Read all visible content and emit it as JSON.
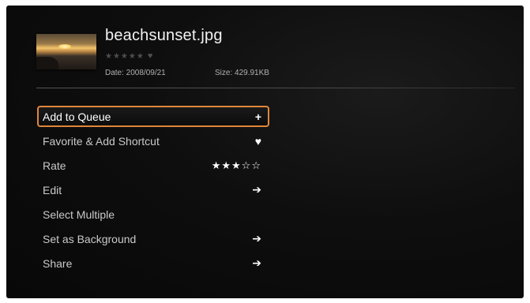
{
  "file": {
    "name": "beachsunset.jpg",
    "rating_stars": "★★★★★",
    "heart_glyph": "♥",
    "date": "Date: 2008/09/21",
    "size": "Size: 429.91KB"
  },
  "menu": {
    "selected_index": 0,
    "items": [
      {
        "label": "Add to Queue",
        "trailing": "+",
        "icon": "plus-icon"
      },
      {
        "label": "Favorite & Add Shortcut",
        "trailing": "♥",
        "icon": "heart-icon"
      },
      {
        "label": "Rate",
        "trailing": "★★★☆☆",
        "icon": "star-rating-icon"
      },
      {
        "label": "Edit",
        "trailing": "➔",
        "icon": "arrow-right-icon"
      },
      {
        "label": "Select Multiple",
        "trailing": "",
        "icon": ""
      },
      {
        "label": "Set as Background",
        "trailing": "➔",
        "icon": "arrow-right-icon"
      },
      {
        "label": "Share",
        "trailing": "➔",
        "icon": "arrow-right-icon"
      }
    ]
  },
  "colors": {
    "accent": "#e0863a",
    "background": "#0e0e0e",
    "text": "#c9c9c9"
  }
}
